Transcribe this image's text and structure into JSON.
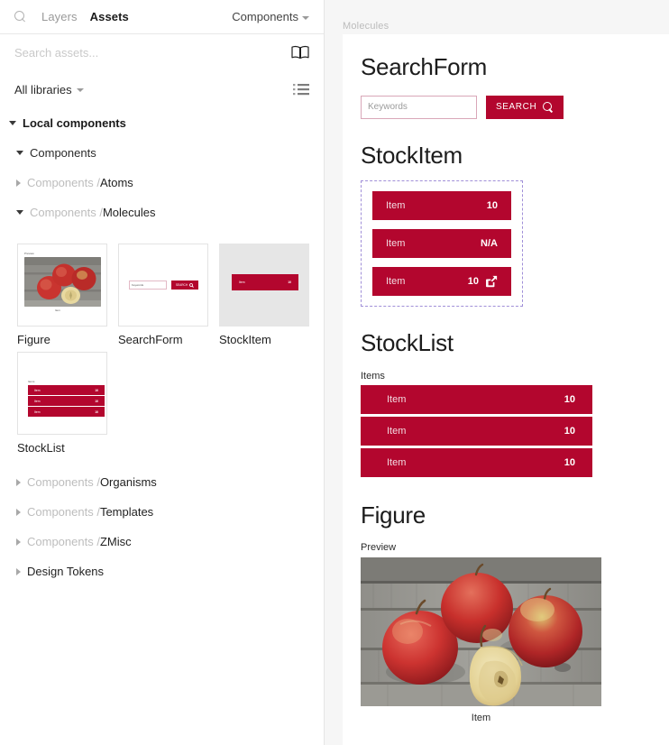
{
  "sidebar": {
    "search_icon": "search-icon",
    "tabs": [
      {
        "label": "Layers",
        "active": false
      },
      {
        "label": "Assets",
        "active": true
      }
    ],
    "filter": {
      "label": "Components",
      "chevron": "chevron-down-icon"
    },
    "search": {
      "placeholder": "Search assets...",
      "value": ""
    },
    "book_icon": "open-book-icon",
    "libraries": {
      "label": "All libraries",
      "chevron": "chevron-down-icon"
    },
    "list_view_icon": "list-view-icon",
    "tree": [
      {
        "label": "Local components",
        "prefix": "",
        "level": 0,
        "expanded": true
      },
      {
        "label": "Components",
        "prefix": "",
        "level": 1,
        "expanded": true
      },
      {
        "label": "Atoms",
        "prefix": "Components / ",
        "level": 1,
        "expanded": false
      },
      {
        "label": "Molecules",
        "prefix": "Components / ",
        "level": 1,
        "expanded": true
      }
    ],
    "tree_lower": [
      {
        "label": "Organisms",
        "prefix": "Components / ",
        "level": 1,
        "expanded": false
      },
      {
        "label": "Templates",
        "prefix": "Components / ",
        "level": 1,
        "expanded": false
      },
      {
        "label": "ZMisc",
        "prefix": "Components / ",
        "level": 1,
        "expanded": false
      },
      {
        "label": "Design Tokens",
        "prefix": "",
        "level": 1,
        "expanded": false
      }
    ],
    "assets": [
      {
        "name": "Figure",
        "thumb": "figure-thumbnail"
      },
      {
        "name": "SearchForm",
        "thumb": "searchform-thumbnail"
      },
      {
        "name": "StockItem",
        "thumb": "stockitem-thumbnail"
      },
      {
        "name": "StockList",
        "thumb": "stocklist-thumbnail"
      }
    ],
    "thumb_text": {
      "preview": "Preview",
      "item": "Item",
      "items": "Items",
      "keywords": "Keywords",
      "search": "SEARCH",
      "qty": "10"
    }
  },
  "canvas": {
    "frame_label": "Molecules",
    "sections": {
      "searchform": {
        "title": "SearchForm",
        "input_placeholder": "Keywords",
        "input_value": "",
        "button_label": "SEARCH",
        "button_icon": "search-icon"
      },
      "stockitem": {
        "title": "StockItem",
        "rows": [
          {
            "name": "Item",
            "value": "10",
            "icon": ""
          },
          {
            "name": "Item",
            "value": "N/A",
            "icon": ""
          },
          {
            "name": "Item",
            "value": "10",
            "icon": "external-link-icon"
          }
        ]
      },
      "stocklist": {
        "title": "StockList",
        "list_label": "Items",
        "rows": [
          {
            "name": "Item",
            "value": "10"
          },
          {
            "name": "Item",
            "value": "10"
          },
          {
            "name": "Item",
            "value": "10"
          }
        ]
      },
      "figure": {
        "title": "Figure",
        "preview_label": "Preview",
        "caption": "Item",
        "image_alt": "three-red-apples-and-a-halved-apple-on-weathered-grey-wooden-planks"
      }
    }
  },
  "colors": {
    "brand_red": "#b3062e",
    "dashed_outline": "#a08fd8",
    "input_border_pink": "#d9a7b8",
    "canvas_bg": "#f6f6f6",
    "thumb_gray": "#e6e6e6"
  }
}
